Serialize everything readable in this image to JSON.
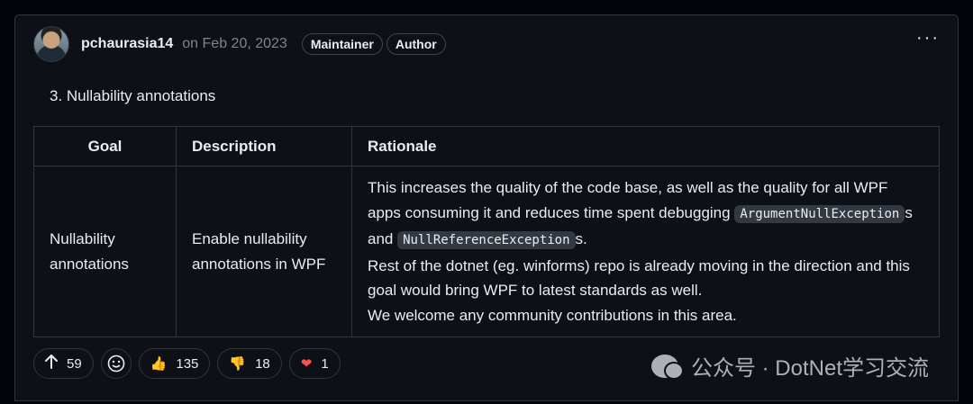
{
  "comment": {
    "author": "pchaurasia14",
    "date": "on Feb 20, 2023",
    "badges": [
      "Maintainer",
      "Author"
    ],
    "menu_icon": "kebab-horizontal-icon",
    "heading": "3. Nullability annotations"
  },
  "table": {
    "headers": [
      "Goal",
      "Description",
      "Rationale"
    ],
    "row": {
      "goal": "Nullability annotations",
      "description": "Enable nullability annotations in WPF",
      "rationale_line1": "This increases the quality of the code base, as well as the quality for all WPF apps consuming it and reduces time spent debugging",
      "code1": "ArgumentNullException",
      "mid1": "s and",
      "code2": "NullReferenceException",
      "mid2": "s.",
      "rationale_line2": "Rest of the dotnet (eg. winforms) repo is already moving in the direction and this goal would bring WPF to latest standards as well.",
      "rationale_line3": "We welcome any community contributions in this area."
    }
  },
  "reactions": {
    "upvote": "59",
    "thumbs_up": "135",
    "thumbs_down": "18",
    "heart": "1"
  },
  "watermark": {
    "text": "公众号 · DotNet学习交流"
  },
  "colors": {
    "background": "#0d1117",
    "border": "#30363d",
    "text": "#e6edf3",
    "muted": "#7d8590"
  }
}
